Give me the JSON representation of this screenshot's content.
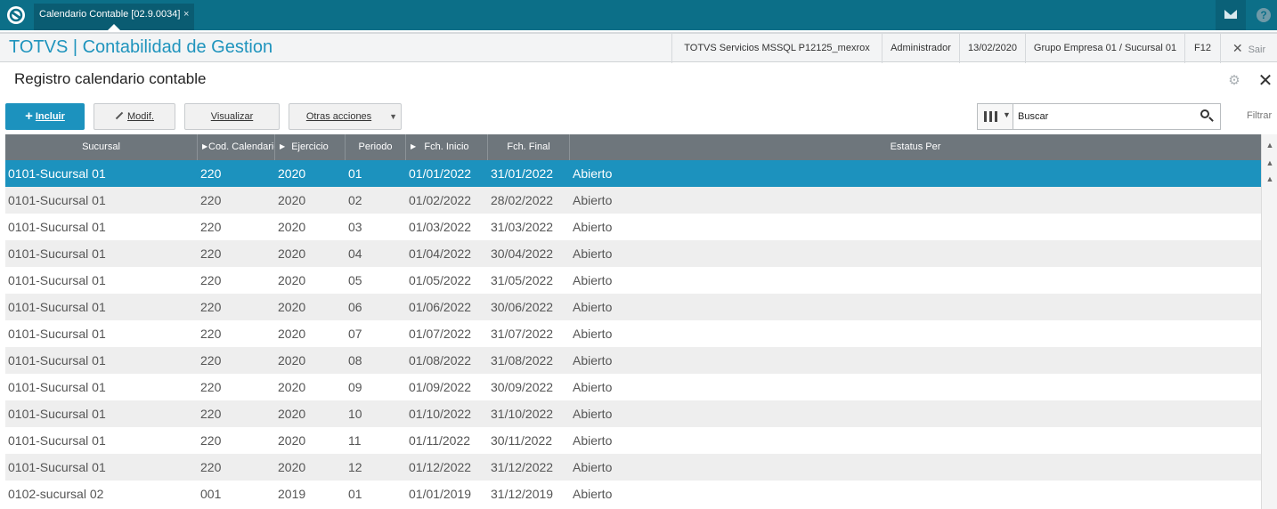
{
  "tab": {
    "title": "Calendario Contable [02.9.0034]",
    "close": "×"
  },
  "header": {
    "app_title": "TOTVS | Contabilidad de Gestion",
    "environment": "TOTVS Servicios MSSQL P12125_mexrox",
    "user": "Administrador",
    "date": "13/02/2020",
    "company": "Grupo Empresa 01 / Sucursal 01",
    "help_key": "F12",
    "exit_label": "Sair"
  },
  "page": {
    "title": "Registro calendario contable"
  },
  "toolbar": {
    "include_label": "Incluir",
    "modify_label": "Modif.",
    "view_label": "Visualizar",
    "more_actions_label": "Otras acciones"
  },
  "search": {
    "placeholder": "Buscar",
    "filter_label": "Filtrar"
  },
  "table": {
    "columns": [
      "Sucursal",
      "Cod. Calendario",
      "Ejercicio",
      "Periodo",
      "Fch. Inicio",
      "Fch. Final",
      "Estatus Per"
    ],
    "rows": [
      [
        "0101-Sucursal 01",
        "220",
        "2020",
        "01",
        "01/01/2022",
        "31/01/2022",
        "Abierto"
      ],
      [
        "0101-Sucursal 01",
        "220",
        "2020",
        "02",
        "01/02/2022",
        "28/02/2022",
        "Abierto"
      ],
      [
        "0101-Sucursal 01",
        "220",
        "2020",
        "03",
        "01/03/2022",
        "31/03/2022",
        "Abierto"
      ],
      [
        "0101-Sucursal 01",
        "220",
        "2020",
        "04",
        "01/04/2022",
        "30/04/2022",
        "Abierto"
      ],
      [
        "0101-Sucursal 01",
        "220",
        "2020",
        "05",
        "01/05/2022",
        "31/05/2022",
        "Abierto"
      ],
      [
        "0101-Sucursal 01",
        "220",
        "2020",
        "06",
        "01/06/2022",
        "30/06/2022",
        "Abierto"
      ],
      [
        "0101-Sucursal 01",
        "220",
        "2020",
        "07",
        "01/07/2022",
        "31/07/2022",
        "Abierto"
      ],
      [
        "0101-Sucursal 01",
        "220",
        "2020",
        "08",
        "01/08/2022",
        "31/08/2022",
        "Abierto"
      ],
      [
        "0101-Sucursal 01",
        "220",
        "2020",
        "09",
        "01/09/2022",
        "30/09/2022",
        "Abierto"
      ],
      [
        "0101-Sucursal 01",
        "220",
        "2020",
        "10",
        "01/10/2022",
        "31/10/2022",
        "Abierto"
      ],
      [
        "0101-Sucursal 01",
        "220",
        "2020",
        "11",
        "01/11/2022",
        "30/11/2022",
        "Abierto"
      ],
      [
        "0101-Sucursal 01",
        "220",
        "2020",
        "12",
        "01/12/2022",
        "31/12/2022",
        "Abierto"
      ],
      [
        "0102-sucursal 02",
        "001",
        "2019",
        "01",
        "01/01/2019",
        "31/12/2019",
        "Abierto"
      ]
    ]
  },
  "colors": {
    "brand": "#0c6f88",
    "accent": "#1c92be",
    "selected_row": "#1c92be",
    "header_bg": "#6e767c"
  },
  "icons": [
    "totvs-logo-icon",
    "mail-icon",
    "help-icon",
    "gear-icon",
    "close-icon",
    "plus-icon",
    "pencil-icon",
    "columns-icon",
    "search-icon"
  ]
}
